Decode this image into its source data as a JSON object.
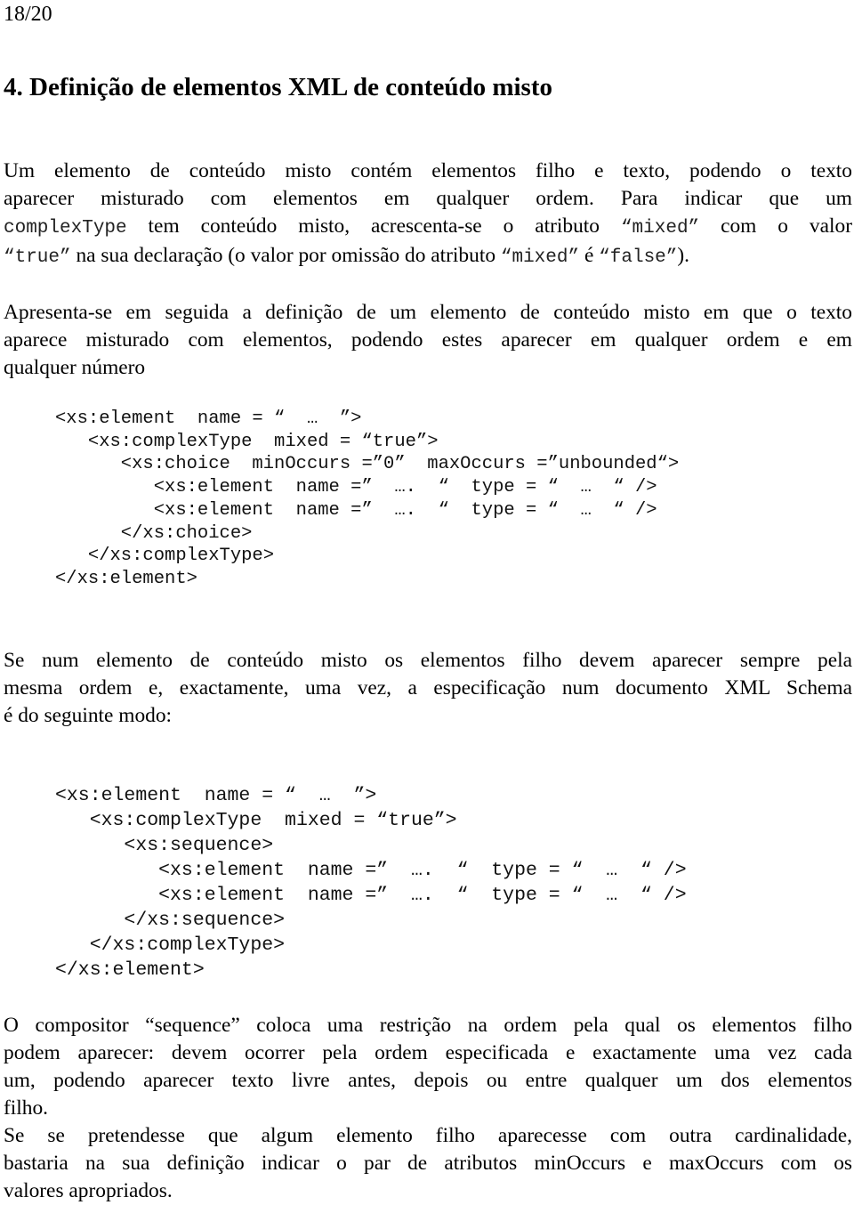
{
  "page_number": "18/20",
  "heading": "4. Definição de elementos XML de conteúdo misto",
  "paragraph1": {
    "line1": "Um elemento de conteúdo misto contém elementos filho e texto, podendo o texto",
    "line2": "aparecer misturado com elementos em qualquer ordem. Para indicar que um",
    "line3_code": "complexType",
    "line3_text": " tem conteúdo misto, acrescenta-se o atributo ",
    "line3_attr": "“mixed”",
    "line3_end": " com o valor",
    "line4_val": "“true”",
    "line4_text": " na sua declaração (o valor por omissão do atributo ",
    "line4_attr": "“mixed”",
    "line4_mid": " é ",
    "line4_false": "“false”",
    "line4_end": ")."
  },
  "paragraph2": [
    "Apresenta-se em seguida a definição de um elemento de conteúdo misto em que o texto",
    "aparece misturado com elementos, podendo estes aparecer em qualquer ordem e em",
    "qualquer número"
  ],
  "code_choice": [
    "<xs:element  name = “  …  ”>",
    "   <xs:complexType  mixed = “true”>",
    "      <xs:choice  minOccurs =”0”  maxOccurs =”unbounded“>",
    "         <xs:element  name =”  ….  “  type = “  …  “ />",
    "         <xs:element  name =”  ….  “  type = “  …  “ />",
    "      </xs:choice>",
    "   </xs:complexType>",
    "</xs:element>"
  ],
  "paragraph3": [
    "Se num elemento de conteúdo misto os elementos filho devem aparecer sempre pela",
    "mesma ordem e, exactamente, uma vez, a especificação num documento XML Schema",
    "é do seguinte modo:"
  ],
  "code_sequence": [
    "<xs:element  name = “  …  ”>",
    "   <xs:complexType  mixed = “true”>",
    "      <xs:sequence>",
    "         <xs:element  name =”  ….  “  type = “  …  “ />",
    "         <xs:element  name =”  ….  “  type = “  …  “ />",
    "      </xs:sequence>",
    "   </xs:complexType>",
    "</xs:element>"
  ],
  "paragraph4": [
    "O compositor “sequence” coloca uma restrição na ordem pela qual os elementos filho",
    "podem aparecer: devem ocorrer pela ordem especificada e exactamente uma vez cada",
    "um, podendo aparecer texto livre antes, depois ou entre qualquer um dos elementos",
    "filho."
  ],
  "paragraph5": [
    "Se se pretendesse que algum elemento filho aparecesse com outra cardinalidade,",
    "bastaria na sua definição indicar o par de atributos minOccurs e maxOccurs com os",
    "valores apropriados."
  ]
}
